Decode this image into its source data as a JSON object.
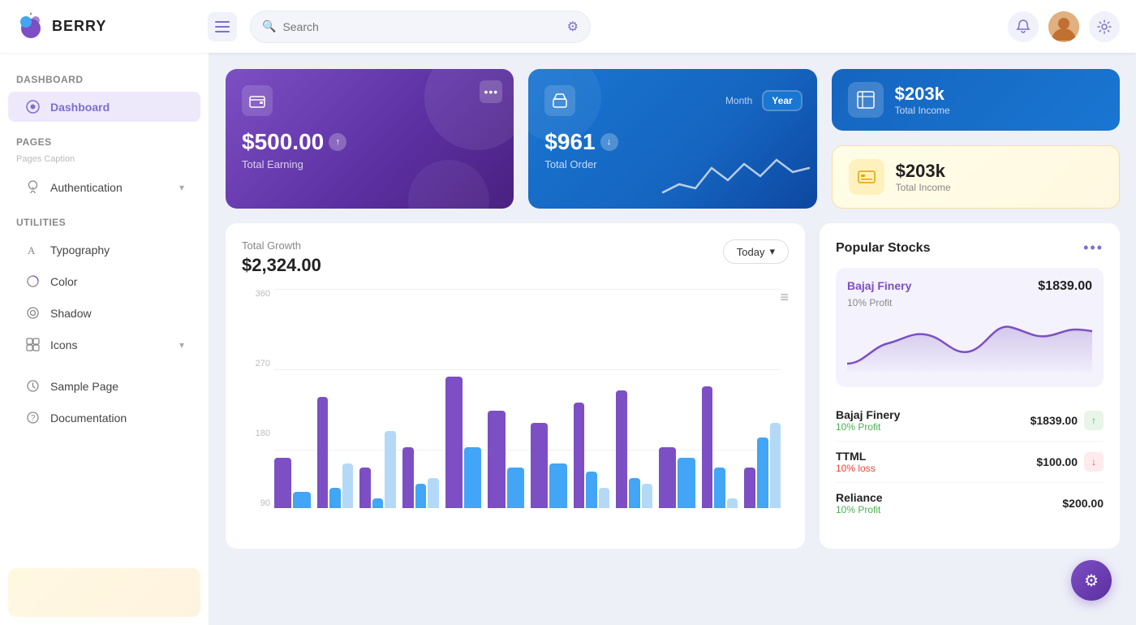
{
  "header": {
    "logo_text": "BERRY",
    "search_placeholder": "Search",
    "menu_label": "menu",
    "bell_label": "notifications",
    "settings_label": "settings"
  },
  "sidebar": {
    "dashboard_section": "Dashboard",
    "dashboard_item": "Dashboard",
    "pages_section": "Pages",
    "pages_caption": "Pages Caption",
    "authentication_item": "Authentication",
    "utilities_section": "Utilities",
    "typography_item": "Typography",
    "color_item": "Color",
    "shadow_item": "Shadow",
    "icons_item": "Icons",
    "other_section": "",
    "sample_page_item": "Sample Page",
    "documentation_item": "Documentation"
  },
  "cards": {
    "earning_amount": "$500.00",
    "earning_label": "Total Earning",
    "order_amount": "$961",
    "order_label": "Total Order",
    "order_tab_month": "Month",
    "order_tab_year": "Year",
    "income_blue_amount": "$203k",
    "income_blue_label": "Total Income",
    "income_yellow_amount": "$203k",
    "income_yellow_label": "Total Income"
  },
  "growth": {
    "title": "Total Growth",
    "amount": "$2,324.00",
    "button_label": "Today",
    "y_labels": [
      "360",
      "270",
      "180",
      "90"
    ],
    "menu_icon": "≡"
  },
  "stocks": {
    "title": "Popular Stocks",
    "more_icon": "•••",
    "featured_name": "Bajaj Finery",
    "featured_price": "$1839.00",
    "featured_profit": "10% Profit",
    "rows": [
      {
        "name": "Bajaj Finery",
        "price": "$1839.00",
        "profit": "10% Profit",
        "profit_type": "positive"
      },
      {
        "name": "TTML",
        "price": "$100.00",
        "profit": "10% loss",
        "profit_type": "negative"
      },
      {
        "name": "Reliance",
        "price": "$200.00",
        "profit": "10% Profit",
        "profit_type": "positive"
      }
    ]
  },
  "fab": {
    "icon": "⚙"
  },
  "chart_bars": [
    {
      "purple": 25,
      "blue": 8,
      "light": 0
    },
    {
      "purple": 55,
      "blue": 10,
      "light": 22
    },
    {
      "purple": 20,
      "blue": 5,
      "light": 38
    },
    {
      "purple": 30,
      "blue": 12,
      "light": 15
    },
    {
      "purple": 65,
      "blue": 30,
      "light": 0
    },
    {
      "purple": 48,
      "blue": 20,
      "light": 0
    },
    {
      "purple": 42,
      "blue": 22,
      "light": 0
    },
    {
      "purple": 52,
      "blue": 18,
      "light": 10
    },
    {
      "purple": 58,
      "blue": 15,
      "light": 12
    },
    {
      "purple": 30,
      "blue": 25,
      "light": 0
    },
    {
      "purple": 60,
      "blue": 20,
      "light": 5
    },
    {
      "purple": 20,
      "blue": 35,
      "light": 42
    }
  ]
}
